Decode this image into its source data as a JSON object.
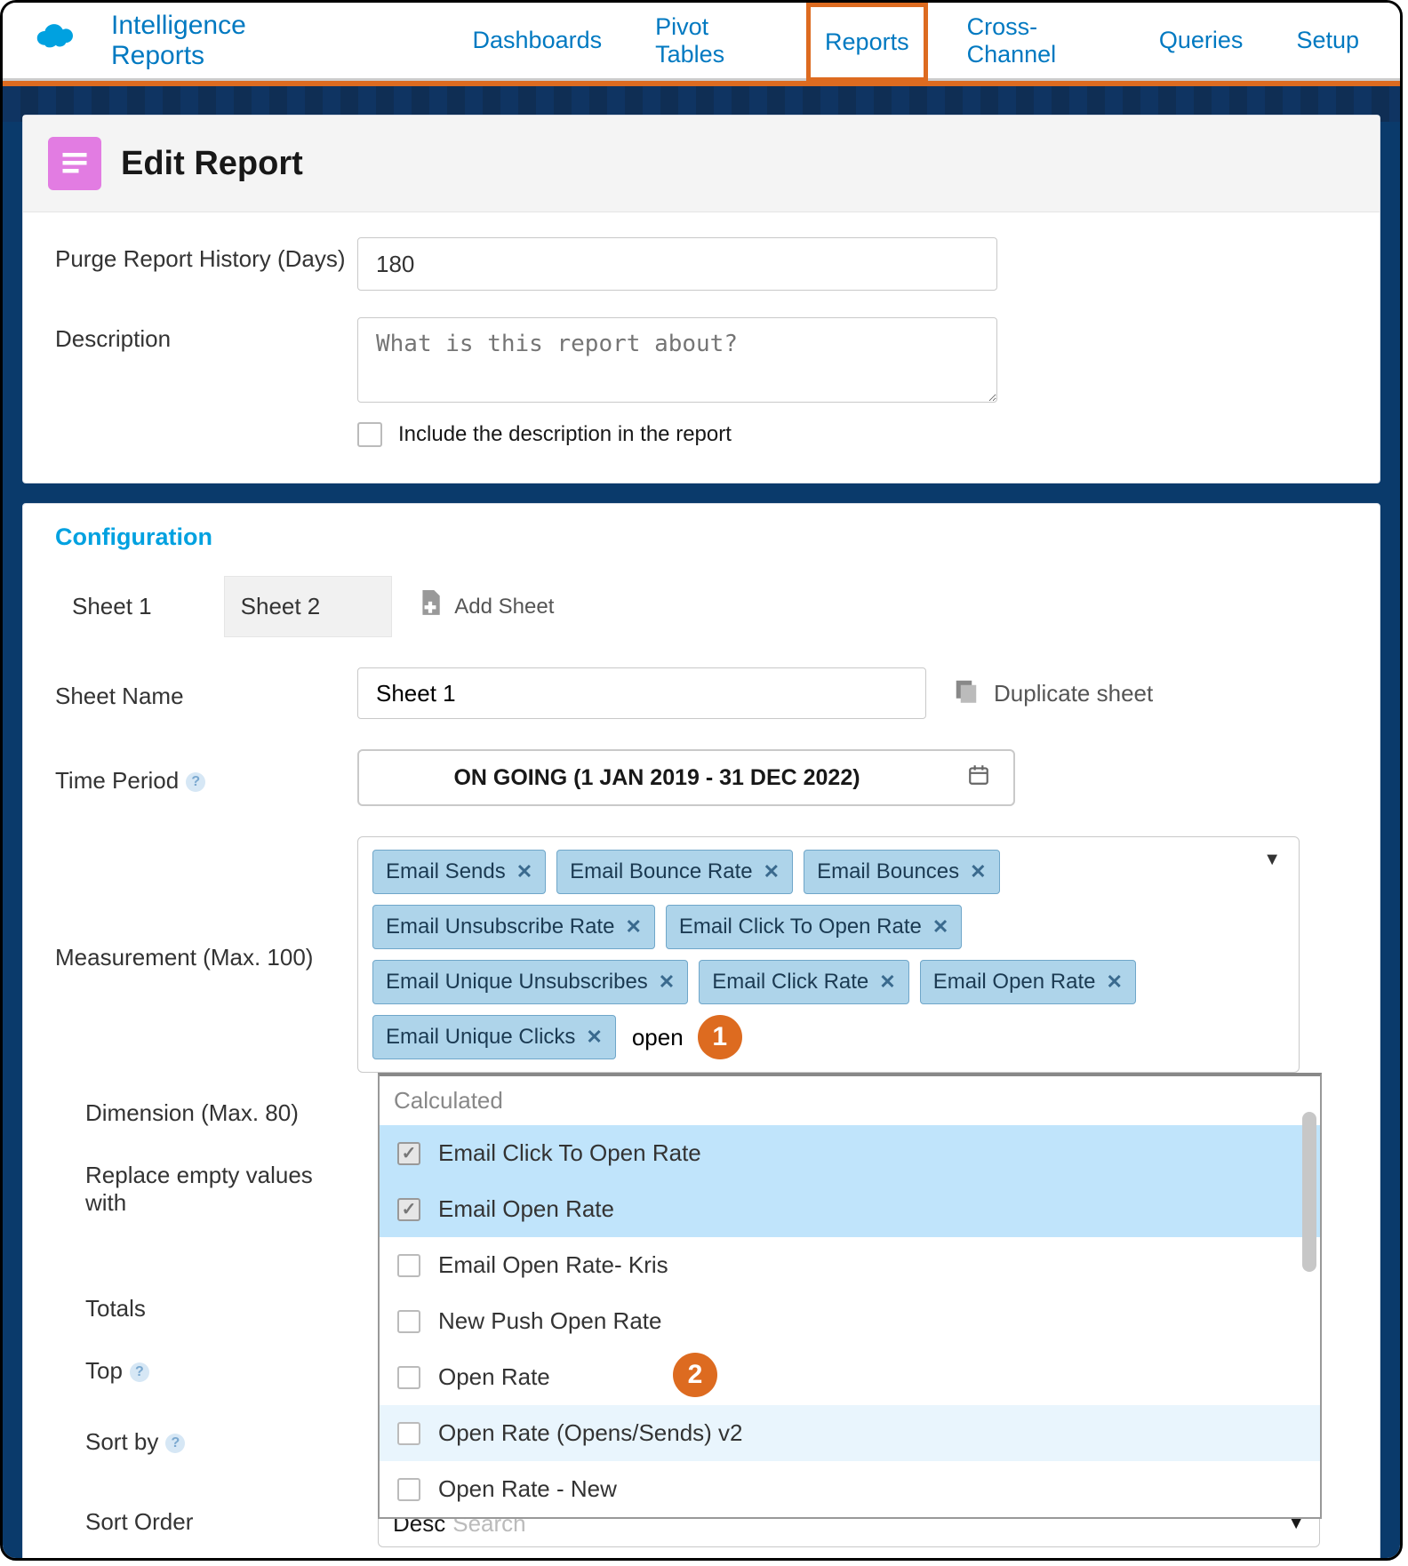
{
  "brand": "Intelligence Reports",
  "nav": {
    "dashboards": "Dashboards",
    "pivot": "Pivot Tables",
    "reports": "Reports",
    "cross": "Cross-Channel",
    "queries": "Queries",
    "setup": "Setup"
  },
  "panel": {
    "title": "Edit Report"
  },
  "form": {
    "purge_label": "Purge Report History (Days)",
    "purge_value": "180",
    "desc_label": "Description",
    "desc_placeholder": "What is this report about?",
    "include_desc": "Include the description in the report"
  },
  "config": {
    "title": "Configuration",
    "sheet1": "Sheet 1",
    "sheet2": "Sheet 2",
    "add_sheet": "Add Sheet",
    "sheet_name_label": "Sheet Name",
    "sheet_name_value": "Sheet 1",
    "duplicate_sheet": "Duplicate sheet",
    "time_label": "Time Period",
    "time_value": "ON GOING (1 JAN 2019 - 31 DEC 2022)",
    "measurement_label": "Measurement (Max. 100)",
    "chips": [
      "Email Sends",
      "Email Bounce Rate",
      "Email Bounces",
      "Email Unsubscribe Rate",
      "Email Click To Open Rate",
      "Email Unique Unsubscribes",
      "Email Click Rate",
      "Email Open Rate",
      "Email Unique Clicks"
    ],
    "search_text": "open",
    "dimension_label": "Dimension (Max. 80)",
    "replace_label_line1": "Replace empty values",
    "replace_label_line2": "with",
    "totals_label": "Totals",
    "top_label": "Top",
    "sortby_label": "Sort by",
    "sortorder_label": "Sort Order",
    "dd_group": "Calculated",
    "dd_items": [
      {
        "label": "Email Click To Open Rate",
        "checked": true
      },
      {
        "label": "Email Open Rate",
        "checked": true
      },
      {
        "label": "Email Open Rate- Kris",
        "checked": false
      },
      {
        "label": "New Push Open Rate",
        "checked": false
      },
      {
        "label": "Open Rate",
        "checked": false
      },
      {
        "label": "Open Rate (Opens/Sends) v2",
        "checked": false
      },
      {
        "label": "Open Rate - New",
        "checked": false
      }
    ],
    "sortorder_value": "Desc",
    "sortorder_placeholder": "Search"
  },
  "callouts": {
    "one": "1",
    "two": "2"
  }
}
